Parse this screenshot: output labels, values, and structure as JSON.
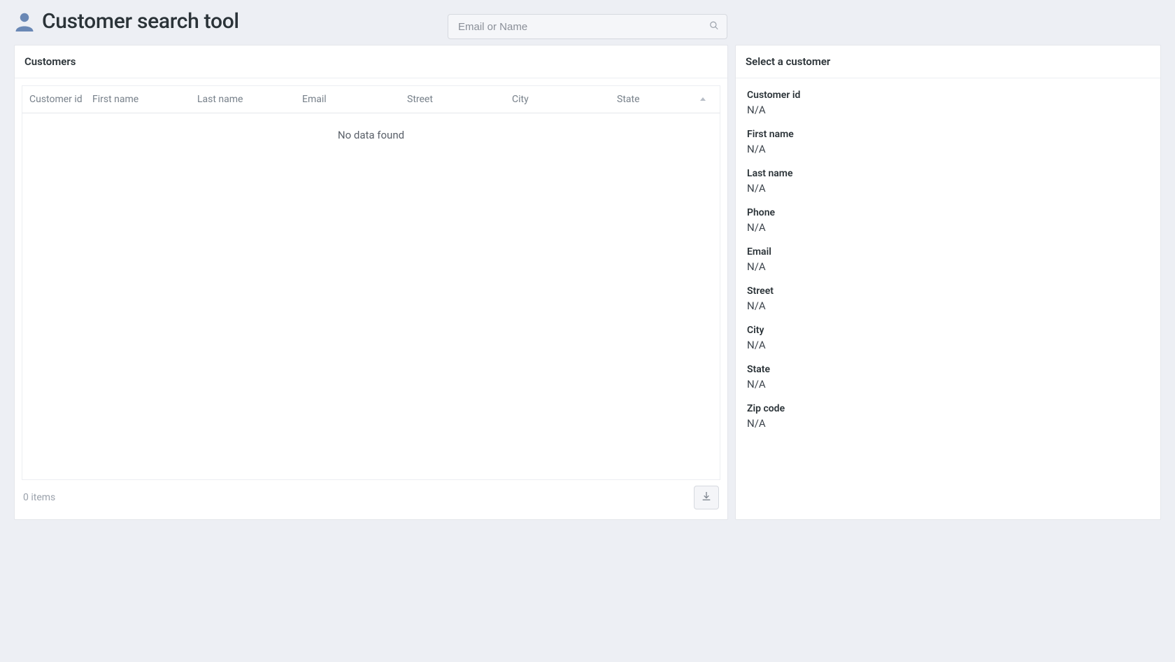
{
  "header": {
    "title": "Customer search tool"
  },
  "search": {
    "placeholder": "Email or Name",
    "value": ""
  },
  "customers_panel": {
    "title": "Customers",
    "columns": {
      "id": "Customer id",
      "first_name": "First name",
      "last_name": "Last name",
      "email": "Email",
      "street": "Street",
      "city": "City",
      "state": "State"
    },
    "empty_message": "No data found",
    "item_count_label": "0 items",
    "rows": []
  },
  "detail_panel": {
    "title": "Select a customer",
    "na": "N/A",
    "fields": [
      {
        "label": "Customer id",
        "value": "N/A"
      },
      {
        "label": "First name",
        "value": "N/A"
      },
      {
        "label": "Last name",
        "value": "N/A"
      },
      {
        "label": "Phone",
        "value": "N/A"
      },
      {
        "label": "Email",
        "value": "N/A"
      },
      {
        "label": "Street",
        "value": "N/A"
      },
      {
        "label": "City",
        "value": "N/A"
      },
      {
        "label": "State",
        "value": "N/A"
      },
      {
        "label": "Zip code",
        "value": "N/A"
      }
    ]
  }
}
